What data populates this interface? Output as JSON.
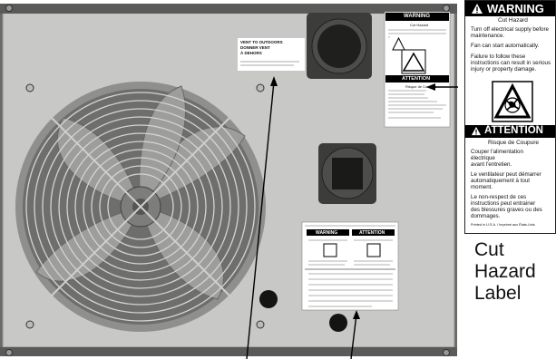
{
  "outdoor_label": {
    "line1": "VENT TO OUTDOORS",
    "line2": "DONNER VENT",
    "line3": "À DEHORS"
  },
  "small_warning": {
    "title": "WARNING",
    "subtitle": "Cut Hazard",
    "fr_title": "ATTENTION",
    "fr_subtitle": "Risque de Coupure"
  },
  "lower_label": {
    "warning": "WARNING",
    "attention": "ATTENTION"
  },
  "callout": {
    "warning_title": "WARNING",
    "warning_subtitle": "Cut Hazard",
    "en_line1": "Turn off electrical supply before",
    "en_line2": "maintenance.",
    "en_line3": "Fan can start automatically.",
    "en_line4": "Failure to follow these",
    "en_line5": "instructions can result in serious",
    "en_line6": "injury or property damage.",
    "attention_title": "ATTENTION",
    "attention_subtitle": "Risque de Coupure",
    "fr_line1": "Couper l'alimentation",
    "fr_line2": "électrique",
    "fr_line3": "avant l'entretien.",
    "fr_line4": "Le ventilateur peut démarrer",
    "fr_line5": "automatiquement à tout",
    "fr_line6": "moment.",
    "fr_line7": "Le non-respect de ces",
    "fr_line8": "instructions peut entrainer",
    "fr_line9": "des blessures graves ou des",
    "fr_line10": "dommages.",
    "footer": "Printed in U.S.A. / Imprimé aux États-Unis"
  },
  "caption": {
    "line1": "Cut",
    "line2": "Hazard",
    "line3": "Label"
  },
  "colors": {
    "panel": "#c9cac7",
    "panel_edge": "#8e8f8c",
    "frame": "#5e5f5c",
    "label_black": "#000000"
  }
}
